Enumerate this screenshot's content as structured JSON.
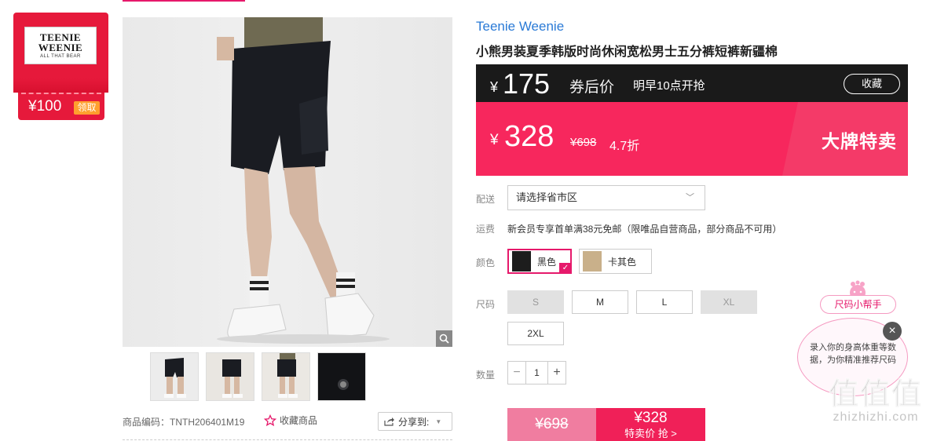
{
  "store": {
    "logo": {
      "line1": "TEENIE",
      "line2": "WEENIE",
      "line3": "ALL THAT BEAR"
    },
    "coupon": {
      "amount": "¥100",
      "claim_label": "领取"
    }
  },
  "gallery": {
    "thumbnails": [
      "black-shorts-front",
      "black-shorts-side",
      "black-shorts-back",
      "pocket-detail"
    ]
  },
  "product_meta": {
    "sku": "商品编码：TNTH206401M19",
    "favorite_label": "收藏商品",
    "share_label": "分享到:"
  },
  "product": {
    "brand": "Teenie Weenie",
    "title": "小熊男装夏季韩版时尚休闲宽松男士五分裤短裤新疆棉"
  },
  "coupon_price": {
    "currency": "¥",
    "price": "175",
    "label": "券后价",
    "time": "明早10点开抢",
    "collect_label": "收藏"
  },
  "sale_price": {
    "currency": "¥",
    "price": "328",
    "original": "¥698",
    "discount": "4.7折",
    "tag": "大牌特卖"
  },
  "shipping": {
    "label": "配送",
    "select_value": "请选择省市区",
    "freight_label": "运费",
    "freight_text": "新会员专享首单满38元免邮（限唯品自营商品，部分商品不可用）"
  },
  "colors": {
    "label": "颜色",
    "options": [
      {
        "name": "黑色",
        "selected": true
      },
      {
        "name": "卡其色",
        "selected": false
      }
    ]
  },
  "sizes": {
    "label": "尺码",
    "options": [
      {
        "name": "S",
        "disabled": true
      },
      {
        "name": "M",
        "disabled": false
      },
      {
        "name": "L",
        "disabled": false
      },
      {
        "name": "XL",
        "disabled": true
      },
      {
        "name": "2XL",
        "disabled": false
      }
    ]
  },
  "quantity": {
    "label": "数量",
    "value": "1",
    "minus": "−",
    "plus": "+"
  },
  "buy": {
    "original": "¥698",
    "price": "¥328",
    "cta": "特卖价 抢 >"
  },
  "size_helper": {
    "button": "尺码小帮手",
    "text": "录入你的身高体重等数据，为你精准推荐尺码",
    "close": "×"
  },
  "watermark": {
    "big": "值值值",
    "small": "zhizhizhi.com"
  },
  "colors_theme": {
    "accent": "#f7275d",
    "brand_blue": "#2a7ad6",
    "dark": "#1a1a1a"
  }
}
